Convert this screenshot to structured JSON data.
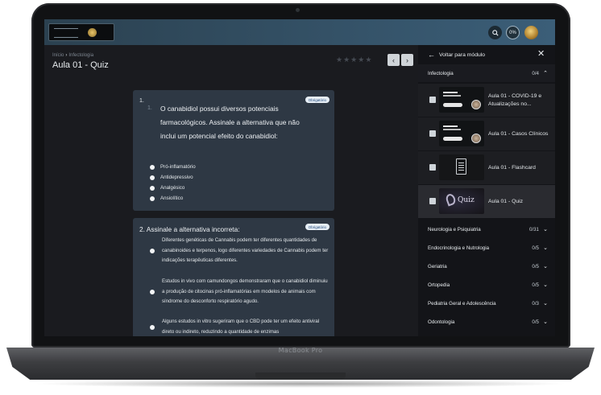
{
  "device": {
    "brand": "MacBook Pro"
  },
  "topbar": {
    "search_icon": "search-icon",
    "progress_text": "0%",
    "avatar_icon": "avatar"
  },
  "main": {
    "breadcrumb": {
      "home": "Início",
      "separator": "›",
      "current": "Infectologia"
    },
    "title": "Aula 01 - Quiz",
    "rating_stars": 5,
    "prev_icon": "chevron-left-icon",
    "next_icon": "chevron-right-icon"
  },
  "questions": [
    {
      "number": "1.",
      "sub_number": "1.",
      "badge": "Obrigatório",
      "text": "O canabidiol possui diversos potenciais farmacológicos. Assinale a alternativa que não inclui um potencial efeito do canabidiol:",
      "options": [
        "Pró-inflamatório",
        "Antidepressivo",
        "Analgésico",
        "Ansiolítico"
      ]
    },
    {
      "number": "2.",
      "title": "Assinale a alternativa incorreta:",
      "badge": "Obrigatório",
      "options": [
        "Diferentes genéticas de Cannabis podem ter diferentes quantidades de canabinoides e terpenos, logo diferentes variedades de Cannabis podem ter indicações terapêuticas diferentes.",
        "Estudos in vivo com camundongos demonstraram que o canabidiol diminuiu a produção de citocinas pró-inflamatórias em modelos de animais com síndrome do desconforto respiratório agudo.",
        "Alguns estudos in vitro sugeriram que o CBD pode ter um efeito antiviral direto ou indireto, reduzindo a quantidade de enzimas"
      ]
    }
  ],
  "sidebar": {
    "back_label": "Voltar para módulo",
    "close_icon": "close-icon",
    "open_section": {
      "name": "Infectologia",
      "count": "0/4"
    },
    "lessons": [
      {
        "title": "Aula 01 - COVID-19 e Atualizações no...",
        "thumb": "covid"
      },
      {
        "title": "Aula 01 - Casos Clínicos",
        "thumb": "covid"
      },
      {
        "title": "Aula 01 - Flashcard",
        "thumb": "flash"
      },
      {
        "title": "Aula 01 - Quiz",
        "thumb": "quiz"
      }
    ],
    "sections": [
      {
        "name": "Neurologia e Psiquiatria",
        "count": "0/31"
      },
      {
        "name": "Endocrinologia e Nutrologia",
        "count": "0/5"
      },
      {
        "name": "Geriatria",
        "count": "0/5"
      },
      {
        "name": "Ortopedia",
        "count": "0/5"
      },
      {
        "name": "Pediatria Geral e Adolescência",
        "count": "0/3"
      },
      {
        "name": "Odontologia",
        "count": "0/5"
      }
    ]
  }
}
